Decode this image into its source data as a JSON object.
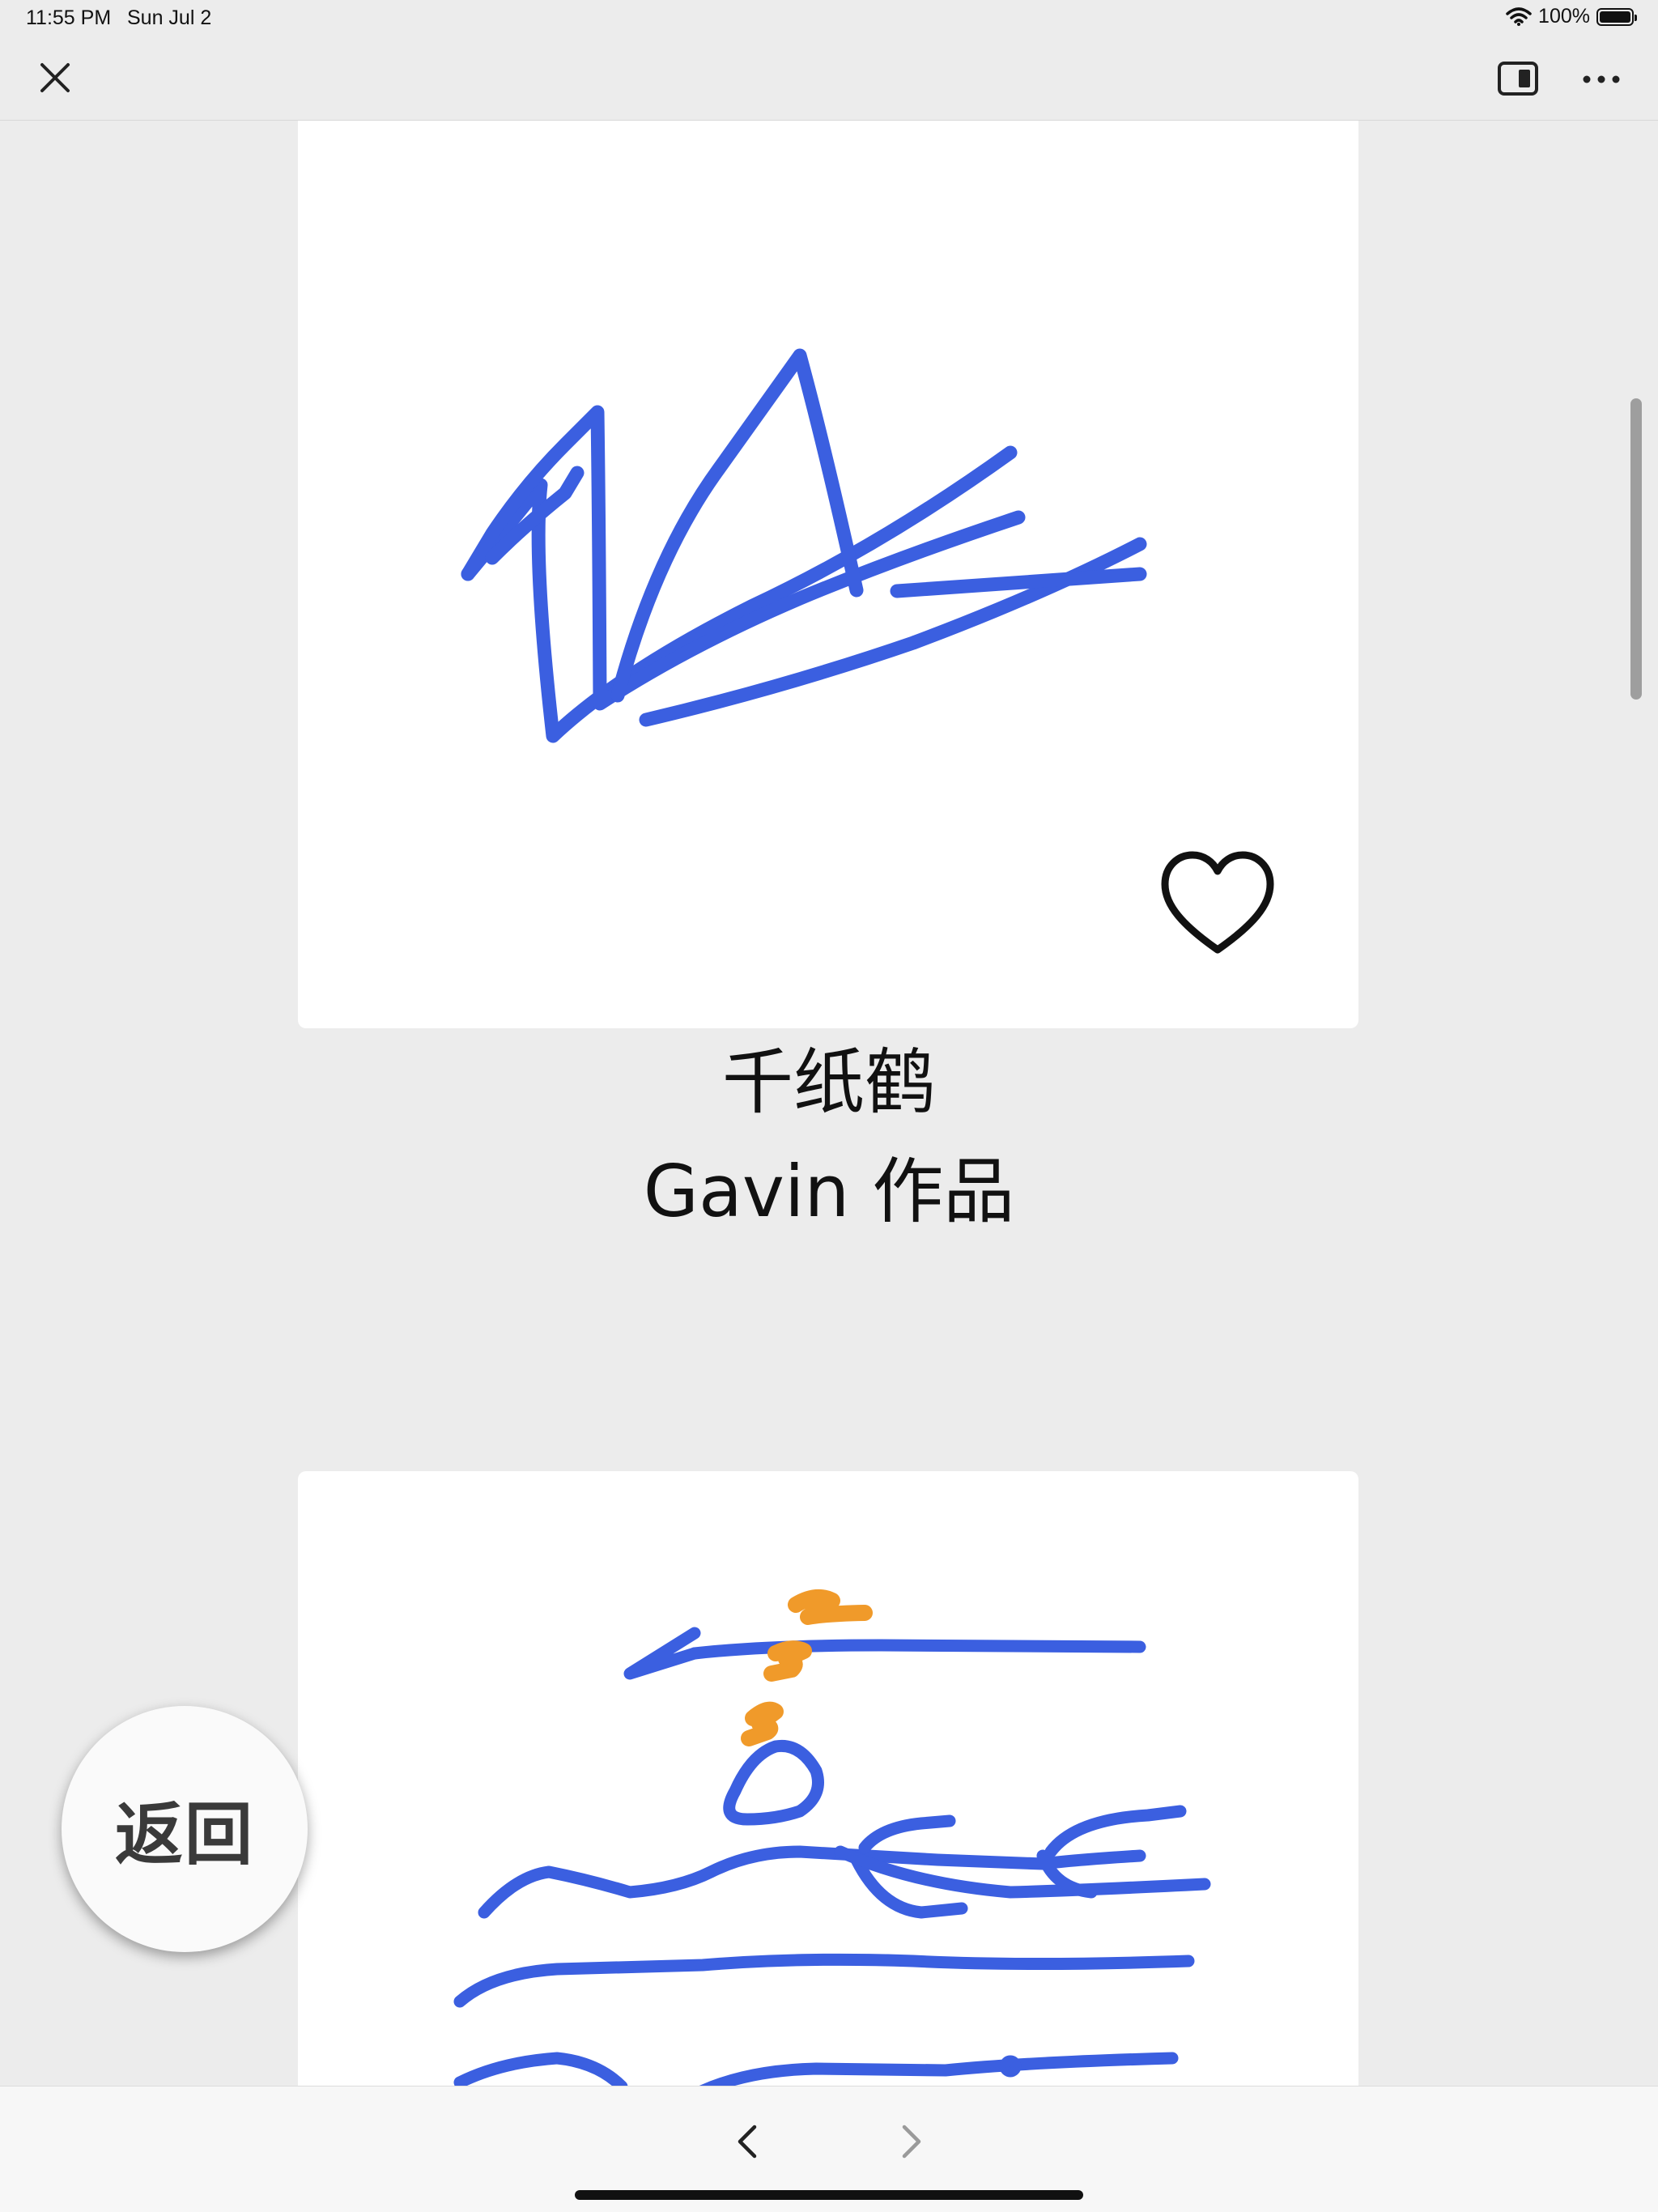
{
  "status_bar": {
    "time": "11:55 PM",
    "date": "Sun Jul 2",
    "battery": "100%",
    "icons": [
      "wifi-icon",
      "battery-icon"
    ]
  },
  "toolbar": {
    "icons": [
      "close-icon",
      "sidebar-toggle-icon",
      "more-icon"
    ]
  },
  "artworks": [
    {
      "title": "千纸鹤",
      "author": "Gavin 作品",
      "icons": [
        "heart-icon"
      ],
      "stroke_color": "#3b5fe0"
    },
    {
      "stroke_color": "#3b5fe0",
      "accent_color": "#f09a2a"
    }
  ],
  "floating": {
    "back_label": "返回"
  },
  "bottom_nav": {
    "icons": [
      "chevron-left-icon",
      "chevron-right-icon"
    ]
  },
  "colors": {
    "background": "#ececec",
    "drawing_blue": "#3b5fe0",
    "drawing_orange": "#f09a2a"
  }
}
